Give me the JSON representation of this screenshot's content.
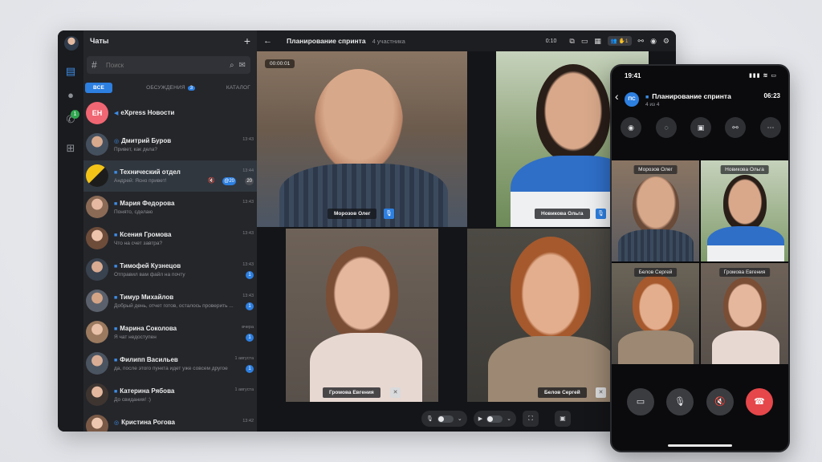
{
  "desktop": {
    "chats_title": "Чаты",
    "add_label": "+",
    "search": {
      "hash": "#",
      "placeholder": "Поиск"
    },
    "filters": [
      {
        "label": "ВСЕ"
      },
      {
        "label": "ОБСУЖДЕНИЯ",
        "count": "3"
      },
      {
        "label": "КАТАЛОГ"
      }
    ],
    "rail_badge": "1",
    "chats": [
      {
        "name": "eXpress Новости",
        "preview": "",
        "time": "",
        "initials": "EH",
        "tag": "◀"
      },
      {
        "name": "Дмитрий Буров",
        "preview": "Привет, как дела?",
        "time": "13:43",
        "tag": "◎"
      },
      {
        "name": "Технический отдел",
        "preview": "Андрей: Ясно привет!",
        "time": "13:44",
        "badge": "@20",
        "badge2": "20",
        "tag": "■"
      },
      {
        "name": "Мария Федорова",
        "preview": "Понято, сделаю",
        "time": "13:43",
        "tag": "■"
      },
      {
        "name": "Ксения Громова",
        "preview": "Что на счет завтра?",
        "time": "13:43",
        "tag": "■"
      },
      {
        "name": "Тимофей Кузнецов",
        "preview": "Отправил вам файл на почту",
        "time": "13:43",
        "badge": "1",
        "tag": "■"
      },
      {
        "name": "Тимур Михайлов",
        "preview": "Добрый день, отчет готов, осталось проверить ...",
        "time": "13:43",
        "badge": "1",
        "tag": "■"
      },
      {
        "name": "Марина Соколова",
        "preview": "Я чат недоступен",
        "time": "вчера",
        "badge": "1",
        "tag": "■"
      },
      {
        "name": "Филипп Васильев",
        "preview": "да, после этого пункта идет уже совсем другое",
        "time": "1 августа",
        "badge": "1",
        "tag": "■"
      },
      {
        "name": "Катерина Рябова",
        "preview": "До свидания! :)",
        "time": "1 августа",
        "tag": "■"
      },
      {
        "name": "Кристина Рогова",
        "preview": "",
        "time": "13:42",
        "tag": "◎"
      }
    ],
    "call": {
      "title": "Планирование спринта",
      "participants": "4 участника",
      "duration": "0:10",
      "hands": "1",
      "timer": "00:00:01",
      "tiles": [
        {
          "name": "Морозов Олег",
          "mic": "on"
        },
        {
          "name": "Новикова Ольга",
          "mic": "on"
        },
        {
          "name": "Громова Евгения",
          "mic": "off"
        },
        {
          "name": "Белов Сергей",
          "mic": "off"
        }
      ]
    }
  },
  "phone": {
    "clock": "19:41",
    "signal": "▮▮▮ ≋ ▭",
    "initials": "ПС",
    "title": "Планирование спринта",
    "subtitle": "4 из 4",
    "duration": "06:23",
    "tiles": [
      {
        "name": "Морозов Олег"
      },
      {
        "name": "Новикова Ольга"
      },
      {
        "name": "Белов Сергей"
      },
      {
        "name": "Громова Евгения"
      }
    ]
  },
  "colors": {
    "accent": "#2d7fe0",
    "call_green": "#2fa84f",
    "end_red": "#e5474a"
  }
}
